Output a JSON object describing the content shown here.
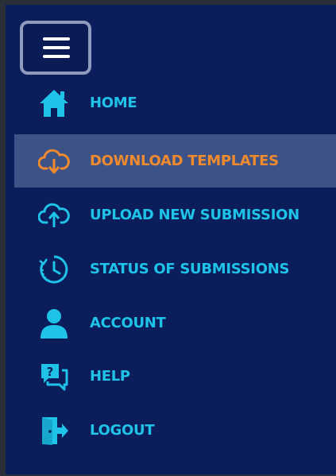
{
  "menu": {
    "toggle_icon": "hamburger-icon"
  },
  "nav": {
    "items": [
      {
        "label": "HOME",
        "icon": "home-icon",
        "active": false
      },
      {
        "label": "DOWNLOAD TEMPLATES",
        "icon": "cloud-download-icon",
        "active": true
      },
      {
        "label": "UPLOAD NEW SUBMISSION",
        "icon": "cloud-upload-icon",
        "active": false
      },
      {
        "label": "STATUS OF SUBMISSIONS",
        "icon": "clock-history-icon",
        "active": false
      },
      {
        "label": "ACCOUNT",
        "icon": "user-icon",
        "active": false
      },
      {
        "label": "HELP",
        "icon": "help-chat-icon",
        "active": false
      },
      {
        "label": "LOGOUT",
        "icon": "logout-door-icon",
        "active": false
      }
    ]
  },
  "colors": {
    "background": "#0b1e5b",
    "label": "#1fc3e8",
    "active_label": "#f08a2e",
    "active_background": "#3d5287"
  }
}
